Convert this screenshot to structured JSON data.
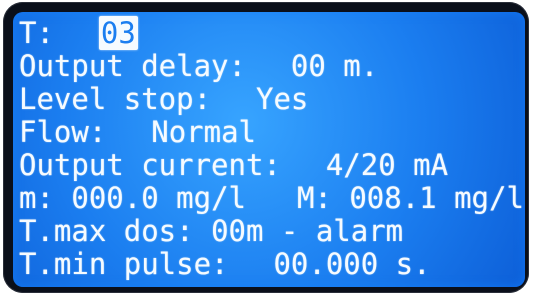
{
  "display": {
    "line1": {
      "label": "T:",
      "value": "03"
    },
    "line2": {
      "label": "Output delay:",
      "value": "00 m."
    },
    "line3": {
      "label": "Level stop:",
      "value": "Yes"
    },
    "line4": {
      "label": "Flow:",
      "value": "Normal"
    },
    "line5": {
      "label": "Output current:",
      "value": "4/20 mA"
    },
    "line6": {
      "m_label": "m:",
      "m_value": "000.0 mg/l",
      "M_label": "M:",
      "M_value": "008.1 mg/l"
    },
    "line7": {
      "label": "T.max dos:",
      "value": "00m - alarm"
    },
    "line8": {
      "label": "T.min pulse:",
      "value": "00.000 s."
    }
  },
  "colors": {
    "lcd_background": "#1b7ef0",
    "text": "#f6fbff",
    "frame": "#0a0f1a"
  }
}
